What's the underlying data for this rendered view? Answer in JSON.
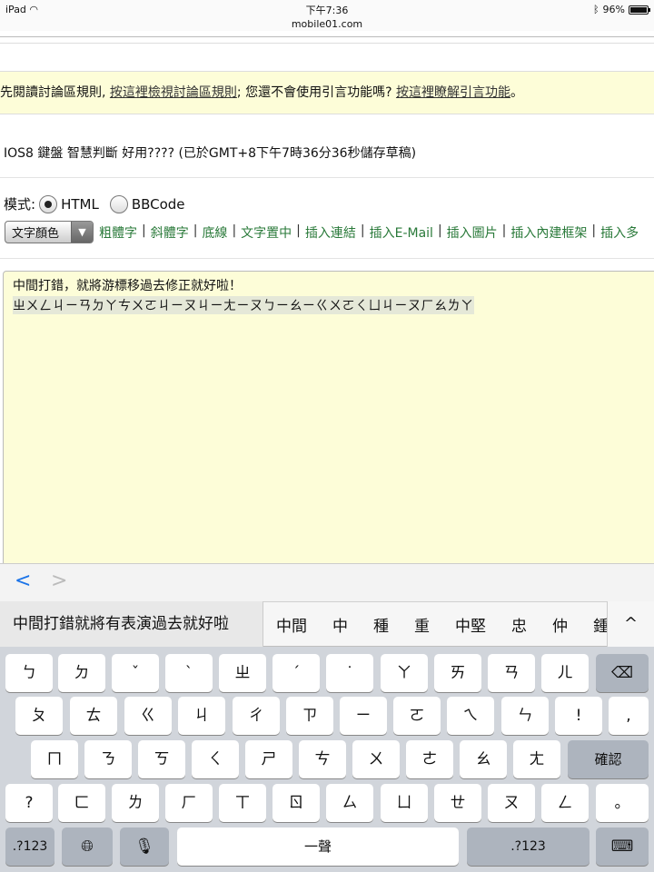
{
  "status": {
    "device": "iPad",
    "time": "下午7:36",
    "domain": "mobile01.com",
    "battery": "96%"
  },
  "notice": {
    "prefix": "先閱讀討論區規則, ",
    "link1": "按這裡檢視討論區規則",
    "middle": "; 您還不會使用引言功能嗎? ",
    "link2": "按這裡瞭解引言功能",
    "suffix": "。"
  },
  "subject": "IOS8 鍵盤 智慧判斷 好用???? (已於GMT+8下午7時36分36秒儲存草稿)",
  "mode": {
    "label": "模式:",
    "html": "HTML",
    "bbcode": "BBCode"
  },
  "toolbar": {
    "color_select": "文字顏色",
    "buttons": [
      "粗體字",
      "斜體字",
      "底線",
      "文字置中",
      "插入連結",
      "插入E-Mail",
      "插入圖片",
      "插入內建框架",
      "插入多"
    ]
  },
  "editor": {
    "line1": "中間打錯，就將游標移過去修正就好啦！",
    "line2": "ㄓㄨㄥㄐㄧㄢㄉㄚㄘㄨㄛㄐㄧㄡㄐㄧㄤㄧㄡㄅㄧㄠㄧㄍㄨㄛㄑㄩㄐㄧㄡㄏㄠㄌㄚ"
  },
  "accessory": {
    "back": "<",
    "forward": ">"
  },
  "candidates": {
    "first": "中間打錯就將有表演過去就好啦",
    "options": [
      "中間",
      "中",
      "種",
      "重",
      "中堅",
      "忠",
      "仲",
      "鍾"
    ],
    "collapse": "^"
  },
  "keyboard": {
    "row1": [
      "ㄅ",
      "ㄉ",
      "ˇ",
      "ˋ",
      "ㄓ",
      "ˊ",
      "˙",
      "ㄚ",
      "ㄞ",
      "ㄢ",
      "ㄦ"
    ],
    "row2": [
      "ㄆ",
      "ㄊ",
      "ㄍ",
      "ㄐ",
      "ㄔ",
      "ㄗ",
      "ㄧ",
      "ㄛ",
      "ㄟ",
      "ㄣ",
      "!",
      ","
    ],
    "row3": [
      "ㄇ",
      "ㄋ",
      "ㄎ",
      "ㄑ",
      "ㄕ",
      "ㄘ",
      "ㄨ",
      "ㄜ",
      "ㄠ",
      "ㄤ"
    ],
    "confirm": "確認",
    "row4": [
      "?",
      "ㄈ",
      "ㄌ",
      "ㄏ",
      "ㄒ",
      "ㄖ",
      "ㄙ",
      "ㄩ",
      "ㄝ",
      "ㄡ",
      "ㄥ",
      "。"
    ],
    "numbers_left": ".?123",
    "space": "一聲",
    "numbers_right": ".?123"
  }
}
